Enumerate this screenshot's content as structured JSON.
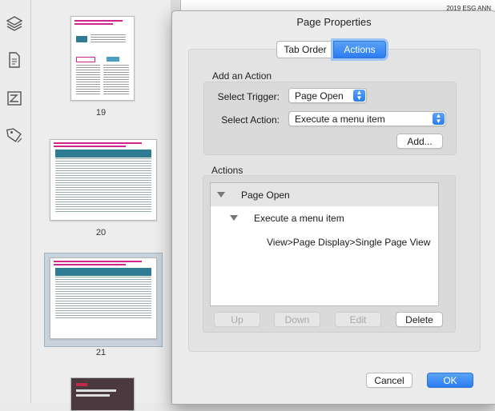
{
  "thumbnails": [
    {
      "page_number": "19"
    },
    {
      "page_number": "20"
    },
    {
      "page_number": "21"
    }
  ],
  "document": {
    "header_text": "2019 ESG ANN"
  },
  "dialog": {
    "title": "Page Properties",
    "tabs": [
      {
        "label": "Tab Order"
      },
      {
        "label": "Actions"
      }
    ],
    "add_action": {
      "section_title": "Add an Action",
      "trigger_label": "Select Trigger:",
      "trigger_value": "Page Open",
      "action_label": "Select Action:",
      "action_value": "Execute a menu item",
      "add_button": "Add..."
    },
    "actions": {
      "section_title": "Actions",
      "tree": [
        {
          "label": "Page Open"
        },
        {
          "label": "Execute a menu item"
        },
        {
          "label": "View>Page Display>Single Page View"
        }
      ],
      "buttons": {
        "up": "Up",
        "down": "Down",
        "edit": "Edit",
        "delete": "Delete"
      }
    },
    "footer": {
      "cancel": "Cancel",
      "ok": "OK"
    }
  },
  "colors": {
    "accent": "#2b7cf0",
    "thumb_magenta": "#d0258a",
    "thumb_teal": "#2e7d95"
  }
}
